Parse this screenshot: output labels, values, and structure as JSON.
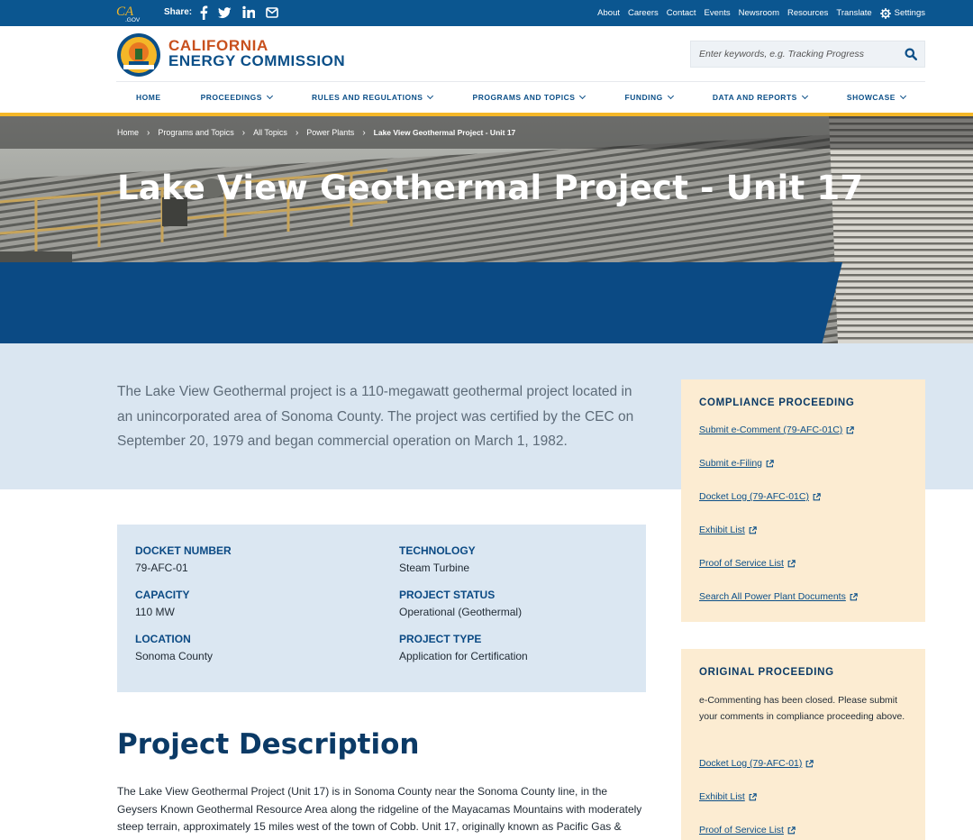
{
  "utility_bar": {
    "logo_text": "CA.GOV",
    "share_label": "Share:",
    "share_icons": [
      "facebook-icon",
      "twitter-icon",
      "linkedin-icon",
      "email-icon"
    ],
    "links": [
      "About",
      "Careers",
      "Contact",
      "Events",
      "Newsroom",
      "Resources",
      "Translate"
    ],
    "settings_label": "Settings"
  },
  "header": {
    "brand_line1": "CALIFORNIA",
    "brand_line2": "ENERGY COMMISSION",
    "search_placeholder": "Enter keywords, e.g. Tracking Progress"
  },
  "nav": {
    "items": [
      {
        "label": "HOME",
        "has_menu": false
      },
      {
        "label": "PROCEEDINGS",
        "has_menu": true
      },
      {
        "label": "RULES AND REGULATIONS",
        "has_menu": true
      },
      {
        "label": "PROGRAMS AND TOPICS",
        "has_menu": true
      },
      {
        "label": "FUNDING",
        "has_menu": true
      },
      {
        "label": "DATA AND REPORTS",
        "has_menu": true
      },
      {
        "label": "SHOWCASE",
        "has_menu": true
      }
    ]
  },
  "breadcrumb": {
    "items": [
      "Home",
      "Programs and Topics",
      "All Topics",
      "Power Plants"
    ],
    "current": "Lake View Geothermal Project - Unit 17"
  },
  "page": {
    "title": "Lake View Geothermal Project - Unit 17",
    "intro": "The Lake View Geothermal project is a 110-megawatt geothermal project located in an unincorporated area of Sonoma County. The project was certified by the CEC on September 20, 1979 and began commercial operation on March 1, 1982."
  },
  "details": {
    "docket_number": {
      "label": "DOCKET NUMBER",
      "value": "79-AFC-01"
    },
    "technology": {
      "label": "TECHNOLOGY",
      "value": "Steam Turbine"
    },
    "capacity": {
      "label": "CAPACITY",
      "value": "110 MW"
    },
    "project_status": {
      "label": "PROJECT STATUS",
      "value": "Operational (Geothermal)"
    },
    "location": {
      "label": "LOCATION",
      "value": "Sonoma County"
    },
    "project_type": {
      "label": "PROJECT TYPE",
      "value": "Application for Certification"
    }
  },
  "description": {
    "title": "Project Description",
    "text": "The Lake View Geothermal Project (Unit 17) is in Sonoma County near the Sonoma County line, in the Geysers Known Geothermal Resource Area along the ridgeline of the Mayacamas Mountains with moderately steep terrain, approximately 15 miles west of the town of Cobb. Unit 17, originally known as Pacific Gas &"
  },
  "sidebar": {
    "compliance": {
      "title": "COMPLIANCE PROCEEDING",
      "links": [
        "Submit e-Comment (79-AFC-01C)",
        "Submit e-Filing",
        "Docket Log (79-AFC-01C)",
        "Exhibit List",
        "Proof of Service List",
        "Search All Power Plant Documents"
      ]
    },
    "original": {
      "title": "ORIGINAL PROCEEDING",
      "note": "e-Commenting has been closed. Please submit your comments in compliance proceeding above.",
      "links": [
        "Docket Log (79-AFC-01)",
        "Exhibit List",
        "Proof of Service List"
      ]
    }
  }
}
